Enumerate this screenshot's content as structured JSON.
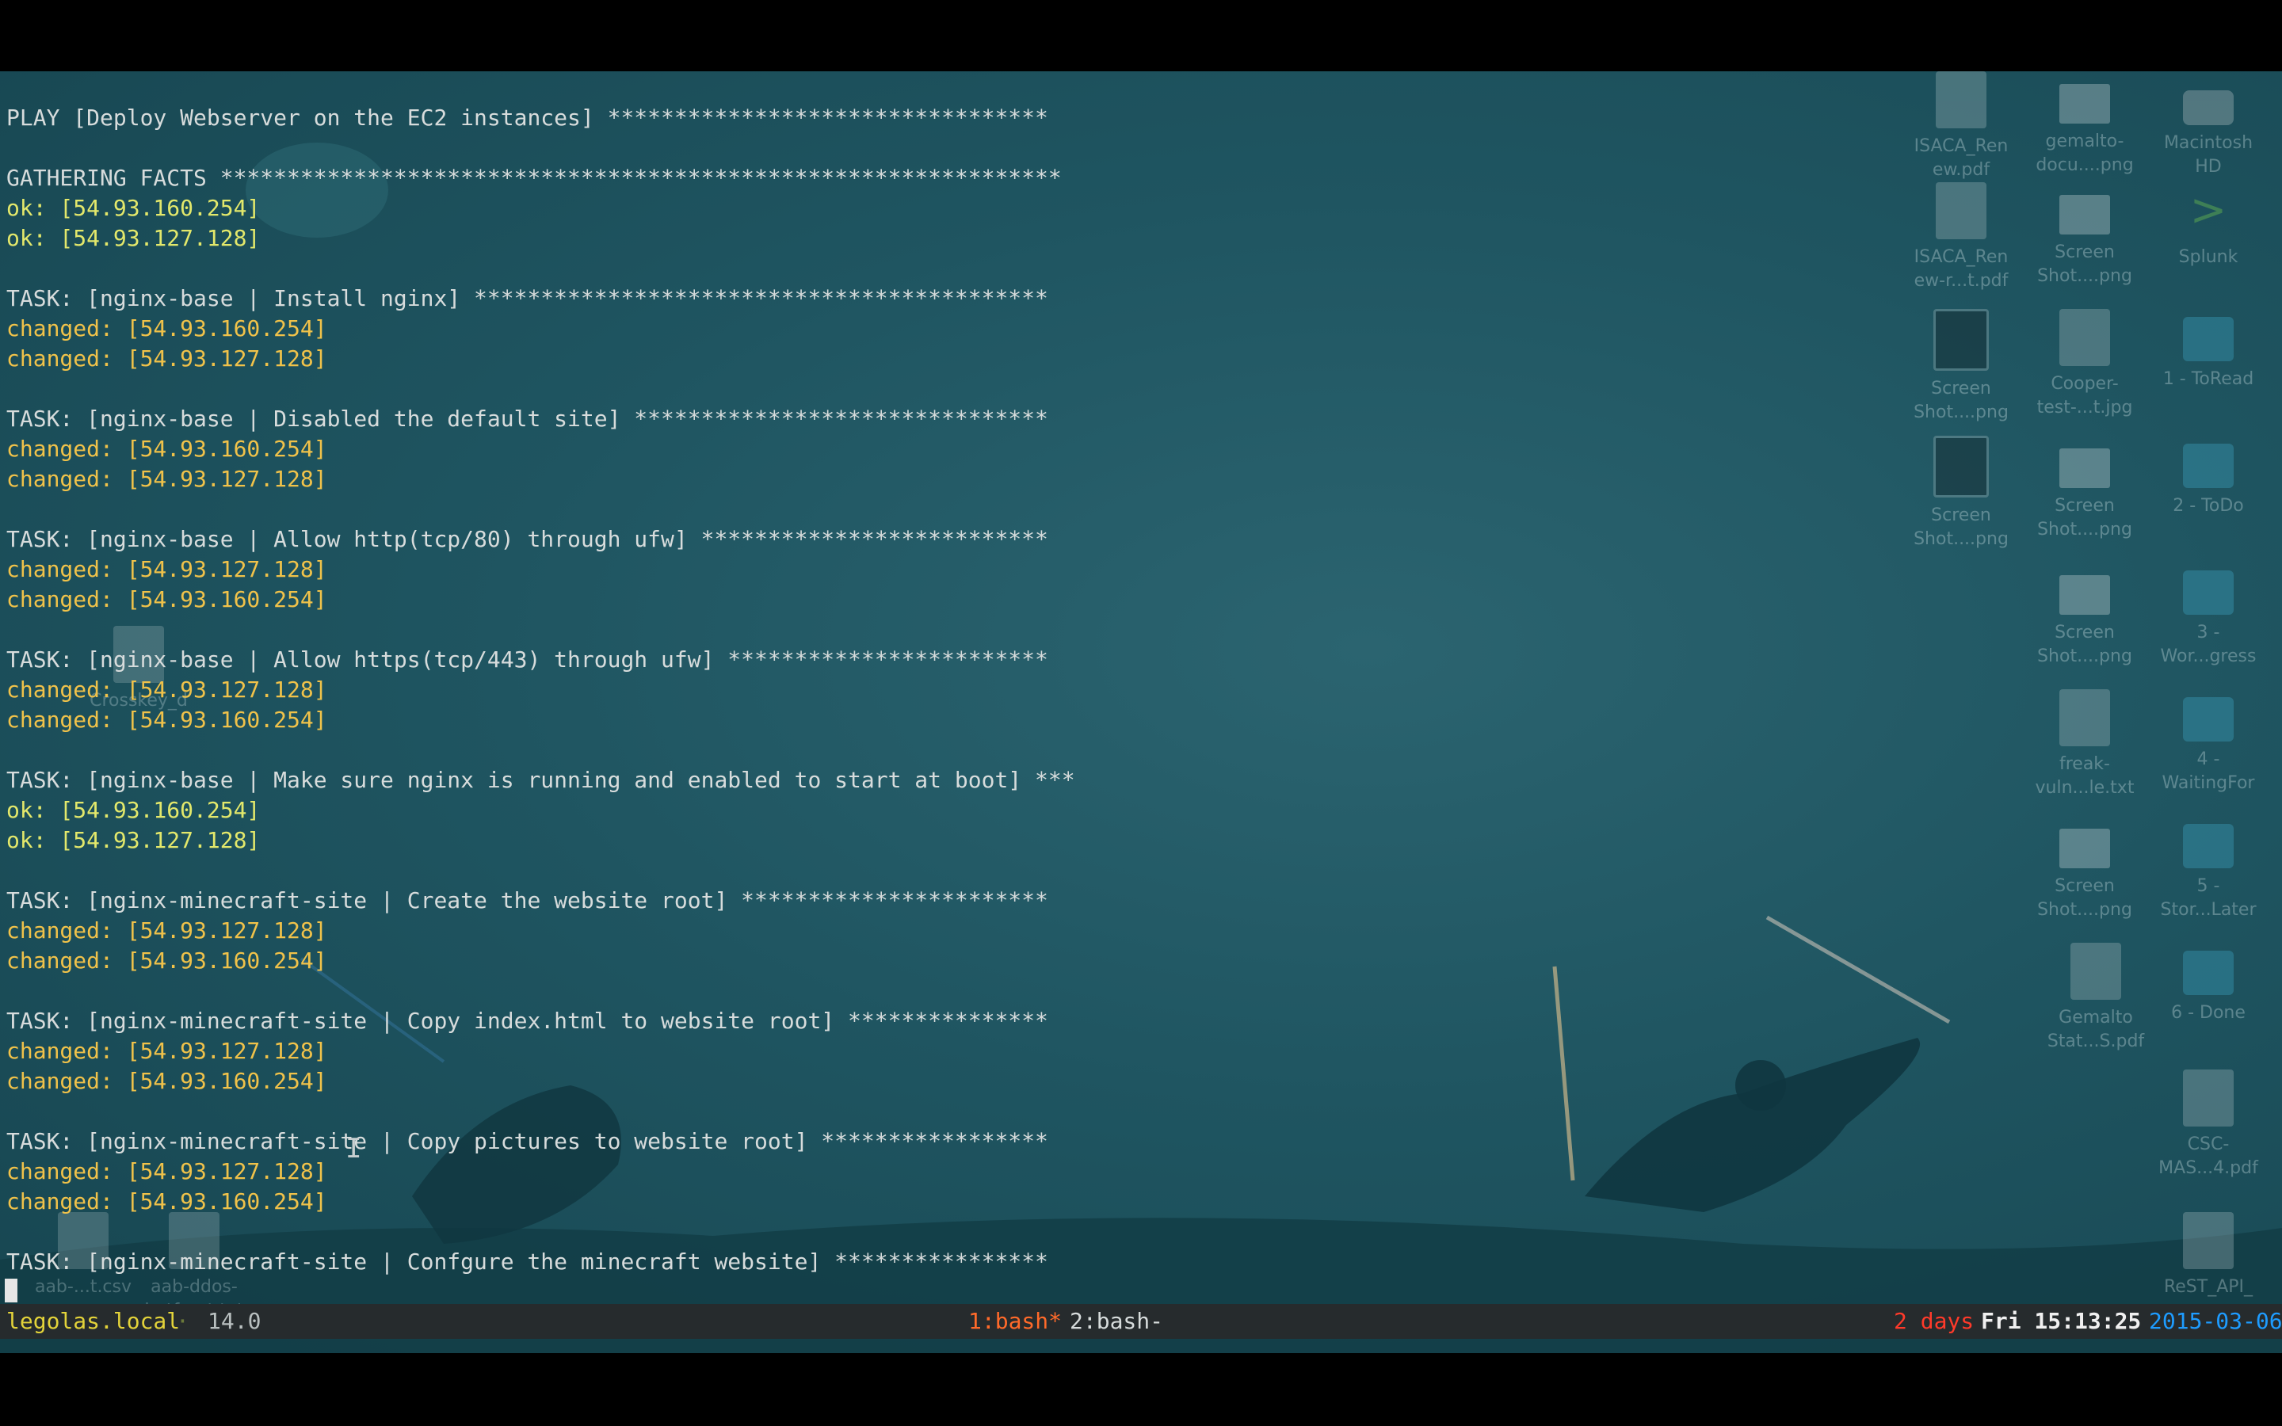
{
  "terminal": {
    "lines": [
      {
        "text": "PLAY [Deploy Webserver on the EC2 instances] *********************************",
        "kind": "header"
      },
      {
        "text": "",
        "kind": "blank"
      },
      {
        "text": "GATHERING FACTS ***************************************************************",
        "kind": "header"
      },
      {
        "text": "ok: [54.93.160.254]",
        "kind": "ok"
      },
      {
        "text": "ok: [54.93.127.128]",
        "kind": "ok"
      },
      {
        "text": "",
        "kind": "blank"
      },
      {
        "text": "TASK: [nginx-base | Install nginx] *******************************************",
        "kind": "header"
      },
      {
        "text": "changed: [54.93.160.254]",
        "kind": "changed"
      },
      {
        "text": "changed: [54.93.127.128]",
        "kind": "changed"
      },
      {
        "text": "",
        "kind": "blank"
      },
      {
        "text": "TASK: [nginx-base | Disabled the default site] *******************************",
        "kind": "header"
      },
      {
        "text": "changed: [54.93.160.254]",
        "kind": "changed"
      },
      {
        "text": "changed: [54.93.127.128]",
        "kind": "changed"
      },
      {
        "text": "",
        "kind": "blank"
      },
      {
        "text": "TASK: [nginx-base | Allow http(tcp/80) through ufw] **************************",
        "kind": "header"
      },
      {
        "text": "changed: [54.93.127.128]",
        "kind": "changed"
      },
      {
        "text": "changed: [54.93.160.254]",
        "kind": "changed"
      },
      {
        "text": "",
        "kind": "blank"
      },
      {
        "text": "TASK: [nginx-base | Allow https(tcp/443) through ufw] ************************",
        "kind": "header"
      },
      {
        "text": "changed: [54.93.127.128]",
        "kind": "changed"
      },
      {
        "text": "changed: [54.93.160.254]",
        "kind": "changed"
      },
      {
        "text": "",
        "kind": "blank"
      },
      {
        "text": "TASK: [nginx-base | Make sure nginx is running and enabled to start at boot] ***",
        "kind": "header"
      },
      {
        "text": "ok: [54.93.160.254]",
        "kind": "ok"
      },
      {
        "text": "ok: [54.93.127.128]",
        "kind": "ok"
      },
      {
        "text": "",
        "kind": "blank"
      },
      {
        "text": "TASK: [nginx-minecraft-site | Create the website root] ***********************",
        "kind": "header"
      },
      {
        "text": "changed: [54.93.127.128]",
        "kind": "changed"
      },
      {
        "text": "changed: [54.93.160.254]",
        "kind": "changed"
      },
      {
        "text": "",
        "kind": "blank"
      },
      {
        "text": "TASK: [nginx-minecraft-site | Copy index.html to website root] ***************",
        "kind": "header"
      },
      {
        "text": "changed: [54.93.127.128]",
        "kind": "changed"
      },
      {
        "text": "changed: [54.93.160.254]",
        "kind": "changed"
      },
      {
        "text": "",
        "kind": "blank"
      },
      {
        "text": "TASK: [nginx-minecraft-site | Copy pictures to website root] *****************",
        "kind": "header"
      },
      {
        "text": "changed: [54.93.127.128]",
        "kind": "changed"
      },
      {
        "text": "changed: [54.93.160.254]",
        "kind": "changed"
      },
      {
        "text": "",
        "kind": "blank"
      },
      {
        "text": "TASK: [nginx-minecraft-site | Confgure the minecraft website] ****************",
        "kind": "header"
      }
    ]
  },
  "statusbar": {
    "host": "legolas.local",
    "separator": "·",
    "load": "14.0",
    "window1": "1:bash*",
    "window2": "2:bash-",
    "uptime": "2 days",
    "clock": "Fri 15:13:25",
    "date": "2015-03-06"
  },
  "desktop_icons": [
    {
      "label": "ISACA_Ren ew.pdf",
      "icon": "document-icon"
    },
    {
      "label": "gemalto- docu....png",
      "icon": "screenshot-icon"
    },
    {
      "label": "Macintosh HD",
      "icon": "disk-icon"
    },
    {
      "label": "ISACA_Ren ew-r...t.pdf",
      "icon": "document-icon"
    },
    {
      "label": "Screen Shot....png",
      "icon": "screenshot-icon"
    },
    {
      "label": "Splunk",
      "icon": "splunk-app-icon"
    },
    {
      "label": "Screen Shot....png",
      "icon": "screenshot-icon"
    },
    {
      "label": "Cooper- test-...t.jpg",
      "icon": "image-icon"
    },
    {
      "label": "1 - ToRead",
      "icon": "folder-icon"
    },
    {
      "label": "Screen Shot....png",
      "icon": "screenshot-icon"
    },
    {
      "label": "Screen Shot....png",
      "icon": "screenshot-icon"
    },
    {
      "label": "2 - ToDo",
      "icon": "folder-icon"
    },
    {
      "label": "Screen Shot....png",
      "icon": "screenshot-icon"
    },
    {
      "label": "3 - Wor...gress",
      "icon": "folder-icon"
    },
    {
      "label": "freak- vuln...le.txt",
      "icon": "text-file-icon"
    },
    {
      "label": "4 - WaitingFor",
      "icon": "folder-icon"
    },
    {
      "label": "Screen Shot....png",
      "icon": "screenshot-icon"
    },
    {
      "label": "5 - Stor...Later",
      "icon": "folder-icon"
    },
    {
      "label": "Gemalto Stat...S.pdf",
      "icon": "document-icon"
    },
    {
      "label": "6 - Done",
      "icon": "folder-icon"
    },
    {
      "label": "CSC- MAS...4.pdf",
      "icon": "document-icon"
    },
    {
      "label": "ReST_API_",
      "icon": "document-icon"
    },
    {
      "label": "Crosskey_d",
      "icon": "document-icon"
    },
    {
      "label": "aab-...t.csv",
      "icon": "document-icon"
    },
    {
      "label": "aab-ddos- botf....rt.txt",
      "icon": "text-file-icon"
    }
  ]
}
